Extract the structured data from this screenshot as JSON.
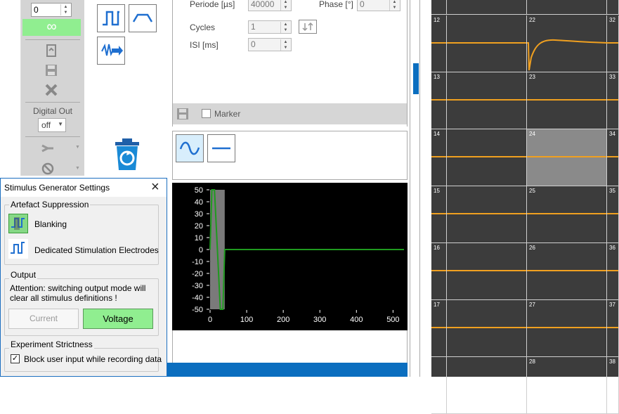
{
  "left_toolbar": {
    "repeat_value": "0",
    "infinite_label": "∞",
    "digital_out_label": "Digital Out",
    "digital_out_value": "off",
    "icons": [
      "reload-file-icon",
      "save-icon",
      "delete-icon",
      "route-icon",
      "disable-icon"
    ]
  },
  "stimulus_buttons": {
    "icons": [
      "square-pulse-icon",
      "trapezoid-pulse-icon",
      "import-waveform-icon",
      "recycle-bin-icon"
    ]
  },
  "parameters": {
    "periode_label": "Periode [µs]",
    "periode_value": "40000",
    "phase_label": "Phase [°]",
    "phase_value": "0",
    "cycles_label": "Cycles",
    "cycles_value": "1",
    "isi_label": "ISI [ms]",
    "isi_value": "0",
    "marker_label": "Marker"
  },
  "waveform_buttons": {
    "icons": [
      "sine-wave-icon",
      "flat-line-icon"
    ]
  },
  "chart_data": {
    "type": "line",
    "x_ticks": [
      "0",
      "100",
      "200",
      "300",
      "400",
      "500"
    ],
    "y_ticks": [
      "50",
      "40",
      "30",
      "20",
      "10",
      "0",
      "-10",
      "-20",
      "-30",
      "-40",
      "-50"
    ],
    "xlim": [
      0,
      530
    ],
    "ylim": [
      -50,
      50
    ],
    "series": [
      {
        "x": [
          0,
          5,
          12,
          20,
          28,
          35,
          40,
          530
        ],
        "y": [
          0,
          50,
          50,
          0,
          -50,
          -50,
          0,
          0
        ]
      }
    ],
    "colors": {
      "background": "#000000",
      "line": "#1f9a1f",
      "highlight": "#7a7a7a",
      "axis_text": "#ffffff"
    }
  },
  "dialog": {
    "title": "Stimulus Generator Settings",
    "close_icon": "×",
    "artefact": {
      "title": "Artefact Suppression",
      "blanking_label": "Blanking",
      "dedicated_label": "Dedicated Stimulation Electrodes"
    },
    "output": {
      "title": "Output",
      "attention": "Attention: switching output mode will clear all stimulus definitions !",
      "current_label": "Current",
      "voltage_label": "Voltage"
    },
    "strictness": {
      "title": "Experiment Strictness",
      "block_label": "Block user input while recording data",
      "block_checked": true
    }
  },
  "grid": {
    "rows": [
      [
        "",
        "",
        "",
        ""
      ],
      [
        "12",
        "",
        "22",
        "32"
      ],
      [
        "13",
        "",
        "23",
        "33"
      ],
      [
        "14",
        "",
        "24",
        "34"
      ],
      [
        "15",
        "",
        "25",
        "35"
      ],
      [
        "16",
        "",
        "26",
        "36"
      ],
      [
        "17",
        "",
        "27",
        "37"
      ],
      [
        "",
        "",
        "28",
        "38"
      ]
    ],
    "colors": {
      "background": "#3c3c3c",
      "trace": "#f0a020",
      "selected": "#8a8a8a",
      "lines": "#cfcfcf"
    }
  }
}
